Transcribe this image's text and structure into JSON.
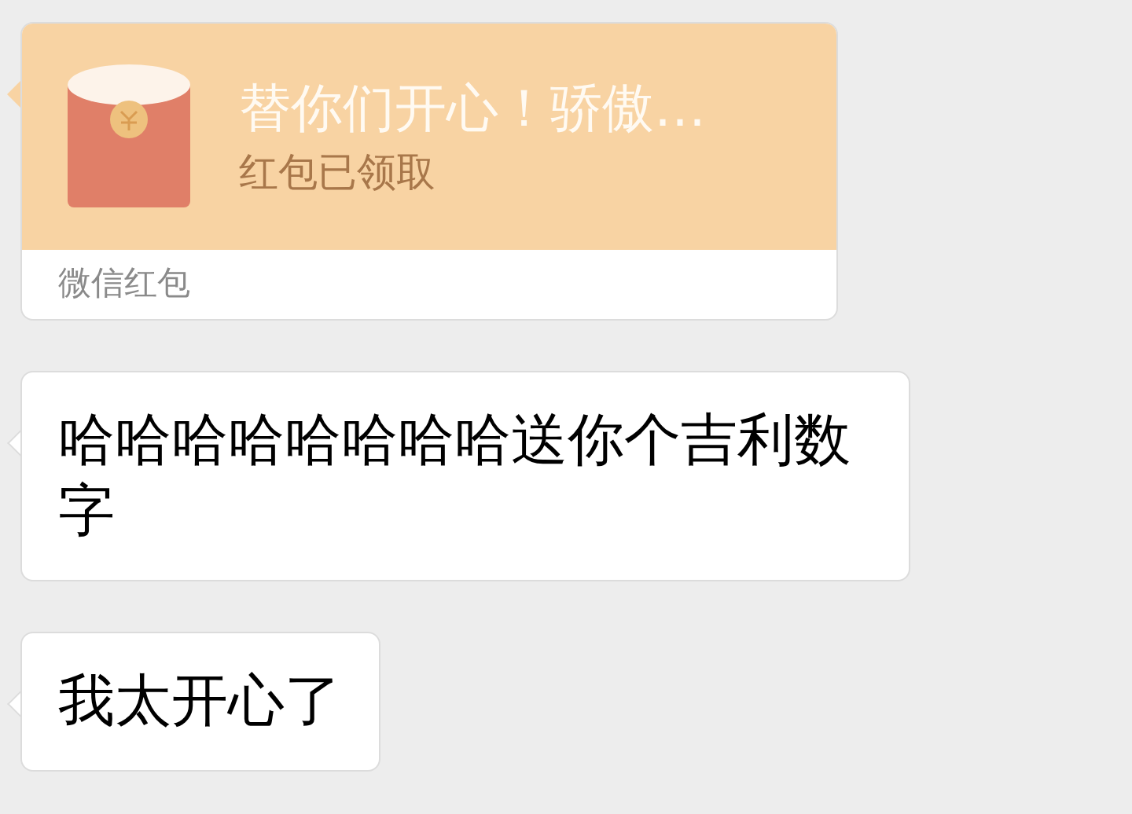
{
  "messages": [
    {
      "kind": "red_packet",
      "title": "替你们开心！骄傲…",
      "status": "红包已领取",
      "footer": "微信红包"
    },
    {
      "kind": "text",
      "text": "哈哈哈哈哈哈哈哈送你个吉利数字"
    },
    {
      "kind": "text",
      "text": "我太开心了"
    }
  ]
}
